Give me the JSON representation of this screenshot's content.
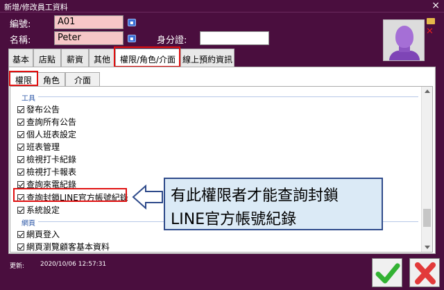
{
  "window": {
    "title": "新增/修改員工資料",
    "close_glyph": "×"
  },
  "form": {
    "id_label": "編號:",
    "id_value": "A01",
    "name_label": "名稱:",
    "name_value": "Peter",
    "national_id_label": "身分證:",
    "national_id_value": ""
  },
  "tabs": [
    "基本",
    "店點",
    "薪資",
    "其他",
    "權限/角色/介面",
    "線上預約資訊"
  ],
  "active_tab": "權限/角色/介面",
  "subtabs": [
    "權限",
    "角色",
    "介面"
  ],
  "active_subtab": "權限",
  "permissions": {
    "group_tools": "工具",
    "tool_items": [
      "發布公告",
      "查詢所有公告",
      "個人班表設定",
      "班表管理",
      "檢視打卡紀錄",
      "檢視打卡報表",
      "查詢來電紀錄",
      "查詢封鎖LINE官方帳號紀錄",
      "系統設定"
    ],
    "group_web": "網頁",
    "web_items": [
      "網頁登入",
      "網頁瀏覽顧客基本資料"
    ]
  },
  "callout": {
    "line1": "有此權限者才能查詢封鎖",
    "line2": "LINE官方帳號紀錄"
  },
  "footer": {
    "updated_label": "更新:",
    "updated_value": "2020/10/06 12:57:31"
  },
  "colors": {
    "background": "#4a0e3e",
    "highlight": "#e01010",
    "callout_bg": "#dbeaf6",
    "ok_green": "#33b233",
    "cancel_red": "#e23a3a"
  },
  "icons": {
    "ok": "check-icon",
    "cancel": "x-icon",
    "avatar": "person-avatar-icon"
  }
}
